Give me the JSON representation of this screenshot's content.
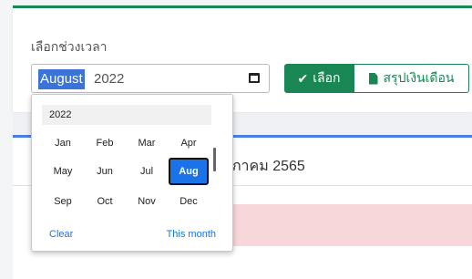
{
  "filter": {
    "label": "เลือกช่วงเวลา",
    "month_value": "August",
    "year_value": "2022",
    "select_button": "เลือก",
    "report_button": "สรุปเงินเดือน"
  },
  "section": {
    "title_fragment": "ภาคม 2565"
  },
  "picker": {
    "year": "2022",
    "months": [
      "Jan",
      "Feb",
      "Mar",
      "Apr",
      "May",
      "Jun",
      "Jul",
      "Aug",
      "Sep",
      "Oct",
      "Nov",
      "Dec"
    ],
    "selected": "Aug",
    "clear": "Clear",
    "this_month": "This month"
  },
  "icons": {
    "check": "check-icon",
    "file": "file-icon",
    "calendar": "calendar-icon"
  },
  "colors": {
    "accent_green": "#198754",
    "accent_blue": "#1a73e8",
    "alert_bg": "#f8d7da"
  }
}
